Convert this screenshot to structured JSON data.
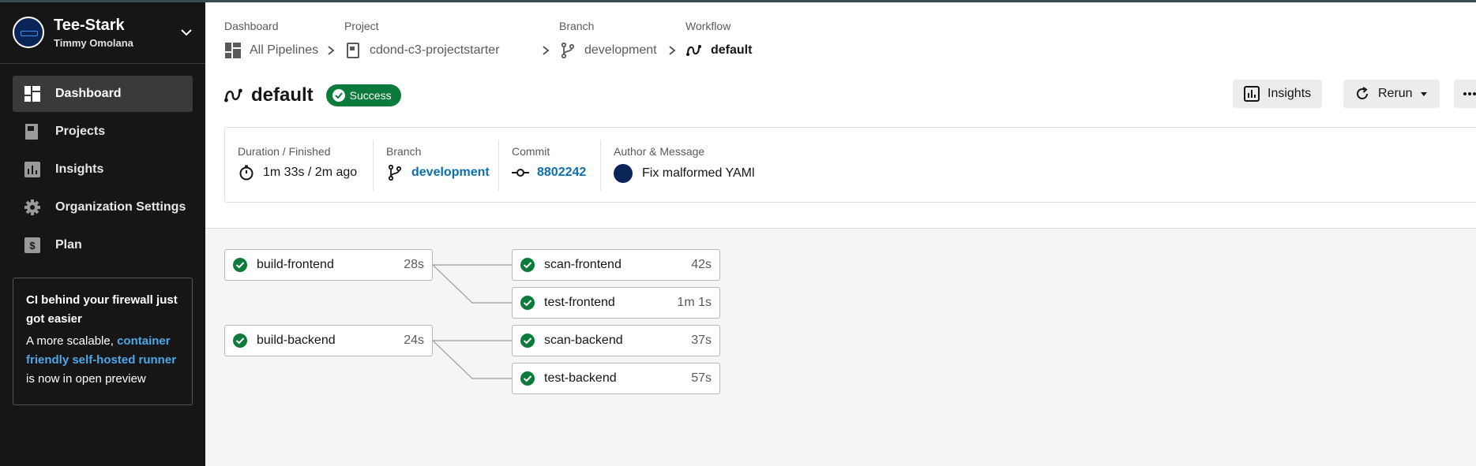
{
  "org": {
    "name": "Tee-Stark",
    "user": "Timmy Omolana"
  },
  "nav": [
    {
      "label": "Dashboard",
      "icon": "dashboard-icon",
      "active": true
    },
    {
      "label": "Projects",
      "icon": "projects-icon"
    },
    {
      "label": "Insights",
      "icon": "insights-icon"
    },
    {
      "label": "Organization Settings",
      "icon": "gear-icon"
    },
    {
      "label": "Plan",
      "icon": "dollar-icon"
    }
  ],
  "promo": {
    "title": "CI behind your firewall just got easier",
    "body_pre": "A more scalable, ",
    "link": "container friendly self-hosted runner",
    "body_post": " is now in open preview"
  },
  "breadcrumb": [
    {
      "label": "Dashboard",
      "value": "All Pipelines"
    },
    {
      "label": "Project",
      "value": "cdond-c3-projectstarter"
    },
    {
      "label": "Branch",
      "value": "development"
    },
    {
      "label": "Workflow",
      "value": "default"
    }
  ],
  "workflow": {
    "title": "default",
    "status": "Success",
    "status_color": "#0b7a3b"
  },
  "actions": {
    "insights": "Insights",
    "rerun": "Rerun"
  },
  "info": {
    "duration_label": "Duration / Finished",
    "duration_value": "1m 33s / 2m ago",
    "branch_label": "Branch",
    "branch_value": "development",
    "commit_label": "Commit",
    "commit_value": "8802242",
    "author_label": "Author & Message",
    "author_message": "Fix malformed YAMl"
  },
  "jobs": [
    {
      "name": "build-frontend",
      "duration": "28s",
      "status": "success"
    },
    {
      "name": "scan-frontend",
      "duration": "42s",
      "status": "success"
    },
    {
      "name": "test-frontend",
      "duration": "1m 1s",
      "status": "success"
    },
    {
      "name": "build-backend",
      "duration": "24s",
      "status": "success"
    },
    {
      "name": "scan-backend",
      "duration": "37s",
      "status": "success"
    },
    {
      "name": "test-backend",
      "duration": "57s",
      "status": "success"
    }
  ]
}
